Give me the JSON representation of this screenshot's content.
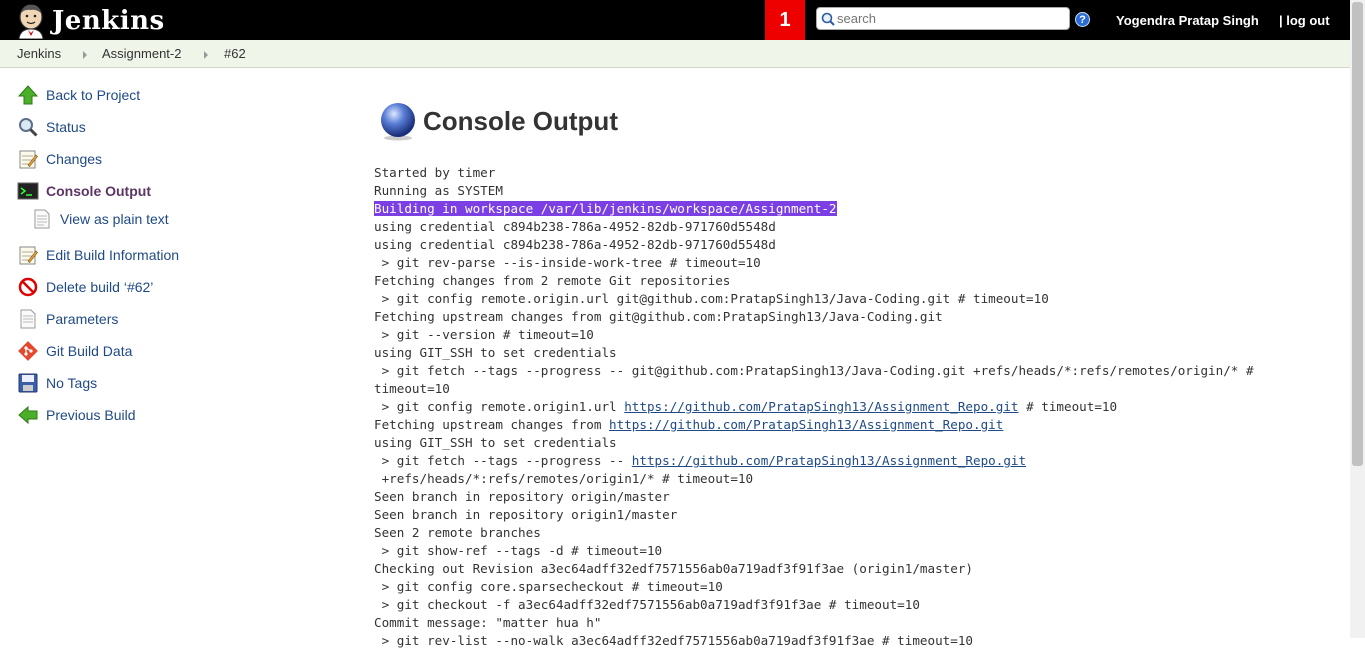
{
  "header": {
    "app_name": "Jenkins",
    "notification_count": "1",
    "search_placeholder": "search",
    "help_label": "?",
    "user_name": "Yogendra Pratap Singh",
    "logout_label": "| log out"
  },
  "breadcrumb": [
    "Jenkins",
    "Assignment-2",
    "#62"
  ],
  "sidebar": {
    "items": [
      {
        "label": "Back to Project",
        "icon": "up-arrow-icon"
      },
      {
        "label": "Status",
        "icon": "magnifier-icon"
      },
      {
        "label": "Changes",
        "icon": "notepad-icon"
      },
      {
        "label": "Console Output",
        "icon": "terminal-icon"
      },
      {
        "label": "View as plain text",
        "icon": "document-icon"
      },
      {
        "label": "Edit Build Information",
        "icon": "notepad-icon"
      },
      {
        "label": "Delete build ‘#62’",
        "icon": "no-entry-icon"
      },
      {
        "label": "Parameters",
        "icon": "document-icon"
      },
      {
        "label": "Git Build Data",
        "icon": "git-icon"
      },
      {
        "label": "No Tags",
        "icon": "floppy-disk-icon"
      },
      {
        "label": "Previous Build",
        "icon": "left-arrow-icon"
      }
    ]
  },
  "main": {
    "title": "Console Output",
    "console_lines": [
      {
        "text": "Started by timer"
      },
      {
        "text": "Running as SYSTEM"
      },
      {
        "text": "Building in workspace /var/lib/jenkins/workspace/Assignment-2",
        "highlight": true
      },
      {
        "text": "using credential c894b238-786a-4952-82db-971760d5548d"
      },
      {
        "text": "using credential c894b238-786a-4952-82db-971760d5548d"
      },
      {
        "text": " > git rev-parse --is-inside-work-tree # timeout=10"
      },
      {
        "text": "Fetching changes from 2 remote Git repositories"
      },
      {
        "text": " > git config remote.origin.url git@github.com:PratapSingh13/Java-Coding.git # timeout=10"
      },
      {
        "text": "Fetching upstream changes from git@github.com:PratapSingh13/Java-Coding.git"
      },
      {
        "text": " > git --version # timeout=10"
      },
      {
        "text": "using GIT_SSH to set credentials"
      },
      {
        "text": " > git fetch --tags --progress -- git@github.com:PratapSingh13/Java-Coding.git +refs/heads/*:refs/remotes/origin/* #"
      },
      {
        "text": "timeout=10"
      },
      {
        "text": " > git config remote.origin1.url ",
        "link": "https://github.com/PratapSingh13/Assignment_Repo.git",
        "after": " # timeout=10"
      },
      {
        "text": "Fetching upstream changes from ",
        "link": "https://github.com/PratapSingh13/Assignment_Repo.git",
        "after": ""
      },
      {
        "text": "using GIT_SSH to set credentials"
      },
      {
        "text": " > git fetch --tags --progress -- ",
        "link": "https://github.com/PratapSingh13/Assignment_Repo.git",
        "after": ""
      },
      {
        "text": " +refs/heads/*:refs/remotes/origin1/* # timeout=10"
      },
      {
        "text": "Seen branch in repository origin/master"
      },
      {
        "text": "Seen branch in repository origin1/master"
      },
      {
        "text": "Seen 2 remote branches"
      },
      {
        "text": " > git show-ref --tags -d # timeout=10"
      },
      {
        "text": "Checking out Revision a3ec64adff32edf7571556ab0a719adf3f91f3ae (origin1/master)"
      },
      {
        "text": " > git config core.sparsecheckout # timeout=10"
      },
      {
        "text": " > git checkout -f a3ec64adff32edf7571556ab0a719adf3f91f3ae # timeout=10"
      },
      {
        "text": "Commit message: \"matter hua h\""
      },
      {
        "text": " > git rev-list --no-walk a3ec64adff32edf7571556ab0a719adf3f91f3ae # timeout=10"
      }
    ]
  }
}
